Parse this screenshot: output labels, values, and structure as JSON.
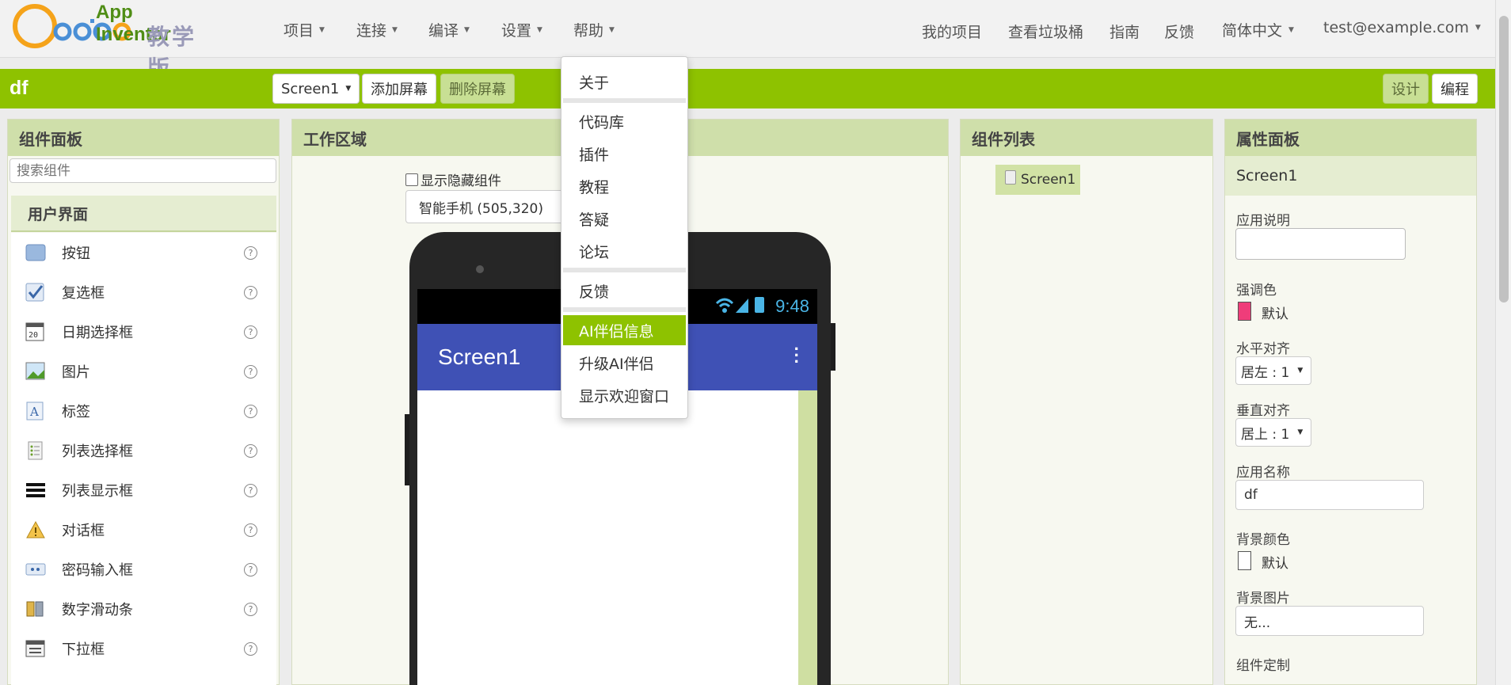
{
  "logo": {
    "brand": "App Inventor",
    "edition": "教学版"
  },
  "nav": {
    "menus": [
      "项目",
      "连接",
      "编译",
      "设置",
      "帮助"
    ],
    "right": [
      "我的项目",
      "查看垃圾桶",
      "指南",
      "反馈"
    ],
    "language": "简体中文",
    "account": "test@example.com"
  },
  "project": {
    "name": "df",
    "screen_select": "Screen1",
    "add_screen": "添加屏幕",
    "remove_screen": "删除屏幕",
    "designer": "设计",
    "blocks": "编程"
  },
  "palette": {
    "title": "组件面板",
    "search_placeholder": "搜索组件",
    "category": "用户界面",
    "items": [
      {
        "label": "按钮",
        "icon": "button-icon"
      },
      {
        "label": "复选框",
        "icon": "checkbox-icon"
      },
      {
        "label": "日期选择框",
        "icon": "calendar-icon"
      },
      {
        "label": "图片",
        "icon": "image-icon"
      },
      {
        "label": "标签",
        "icon": "label-icon"
      },
      {
        "label": "列表选择框",
        "icon": "listpicker-icon"
      },
      {
        "label": "列表显示框",
        "icon": "listview-icon"
      },
      {
        "label": "对话框",
        "icon": "warning-icon"
      },
      {
        "label": "密码输入框",
        "icon": "password-icon"
      },
      {
        "label": "数字滑动条",
        "icon": "slider-icon"
      },
      {
        "label": "下拉框",
        "icon": "spinner-icon"
      }
    ],
    "help_glyph": "?"
  },
  "viewer": {
    "title": "工作区域",
    "show_hidden": "显示隐藏组件",
    "device": "智能手机 (505,320)",
    "status_time": "9:48",
    "screen_title": "Screen1"
  },
  "components": {
    "title": "组件列表",
    "tree": [
      "Screen1"
    ]
  },
  "properties": {
    "title": "属性面板",
    "screen": "Screen1",
    "about_label": "应用说明",
    "accent_label": "强调色",
    "accent_value": "默认",
    "accent_color": "#ef3d7a",
    "halign_label": "水平对齐",
    "halign_value": "居左 : 1",
    "valign_label": "垂直对齐",
    "valign_value": "居上 : 1",
    "appname_label": "应用名称",
    "appname_value": "df",
    "bgcolor_label": "背景颜色",
    "bgcolor_value": "默认",
    "bgimage_label": "背景图片",
    "bgimage_value": "无...",
    "theme_label": "组件定制"
  },
  "help_menu": {
    "items_a": [
      "关于"
    ],
    "items_b": [
      "代码库",
      "插件",
      "教程",
      "答疑",
      "论坛"
    ],
    "items_c": [
      "反馈"
    ],
    "items_d": [
      "AI伴侣信息",
      "升级AI伴侣",
      "显示欢迎窗口"
    ],
    "active": "AI伴侣信息"
  },
  "colors": {
    "green": "#8ec200",
    "panel_head": "#cfdfaa",
    "app_bar": "#3f51b5"
  }
}
